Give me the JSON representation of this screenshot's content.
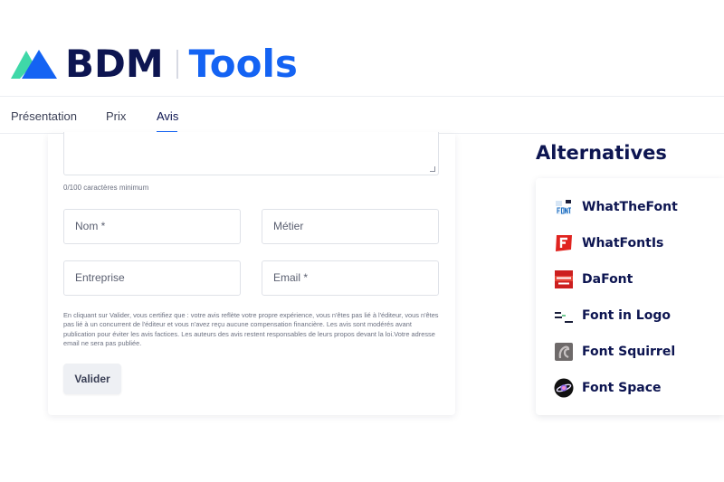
{
  "brand": {
    "name_left": "BDM",
    "name_right": "Tools",
    "logo_icon": "triangle-logo-icon",
    "colors": {
      "navy": "#0d1551",
      "blue": "#1463f3",
      "green": "#3fd8a8"
    }
  },
  "tabs": [
    {
      "label": "Présentation"
    },
    {
      "label": "Prix"
    },
    {
      "label": "Avis",
      "active": true
    }
  ],
  "review_form": {
    "review_text": {
      "value": "",
      "char_count": "0/100 caractères minimum"
    },
    "fields": {
      "name": {
        "placeholder": "Nom *"
      },
      "job": {
        "placeholder": "Métier"
      },
      "company": {
        "placeholder": "Entreprise"
      },
      "email": {
        "placeholder": "Email *"
      }
    },
    "disclaimer": "En cliquant sur Valider, vous certifiez que : votre avis reflète votre propre expérience, vous n'êtes pas lié à l'éditeur, vous n'êtes pas lié à un concurrent de l'éditeur et vous n'avez reçu aucune compensation financière. Les avis sont modérés avant publication pour éviter les avis factices. Les auteurs des avis restent responsables de leurs propos devant la loi.Votre adresse email ne sera pas publiée.",
    "submit_label": "Valider"
  },
  "alternatives": {
    "title": "Alternatives",
    "items": [
      {
        "label": "WhatTheFont",
        "icon": "whatthefont-icon"
      },
      {
        "label": "WhatFontIs",
        "icon": "whatfontis-icon"
      },
      {
        "label": "DaFont",
        "icon": "dafont-icon"
      },
      {
        "label": "Font in Logo",
        "icon": "fontinlogo-icon"
      },
      {
        "label": "Font Squirrel",
        "icon": "fontsquirrel-icon"
      },
      {
        "label": "Font Space",
        "icon": "fontspace-icon"
      }
    ]
  }
}
